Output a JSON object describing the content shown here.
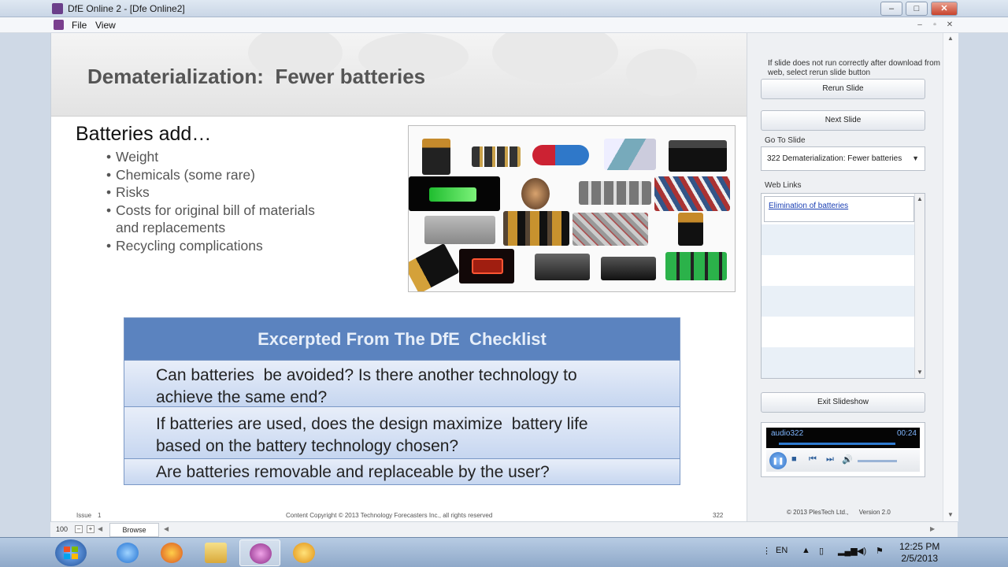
{
  "window": {
    "title": "DfE Online 2 - [Dfe Online2]",
    "min_label": "–",
    "max_label": "□",
    "close_label": "✕"
  },
  "menu": {
    "items": [
      "File",
      "View"
    ],
    "mdi": [
      "–",
      "▫",
      "✕"
    ]
  },
  "slide": {
    "title": "Dematerialization:  Fewer batteries",
    "lead": "Batteries add…",
    "bullets": [
      "Weight",
      "Chemicals (some rare)",
      "Risks",
      "Costs for original bill of materials",
      "Recycling complications"
    ],
    "bullet_continuation": "and replacements",
    "photo_alt": "batteries-collage",
    "checklist": {
      "header": "Excerpted From The DfE  Checklist",
      "rows": [
        [
          "Can batteries  be avoided? Is there another technology to",
          "achieve the same end?"
        ],
        [
          "If batteries are used, does the design maximize  battery life",
          "based on the battery technology chosen?"
        ],
        [
          "Are batteries removable and replaceable by the user?"
        ]
      ]
    },
    "footer": {
      "issue_label": "Issue",
      "issue_number": "1",
      "copyright": "Content Copyright © 2013 Technology Forecasters Inc., all rights reserved",
      "page": "322"
    }
  },
  "panel": {
    "hint": "If slide does not run correctly after download from web, select rerun slide button",
    "rerun_label": "Rerun Slide",
    "next_label": "Next Slide",
    "goto_label": "Go To Slide",
    "goto_value": "322 Dematerialization:  Fewer batteries",
    "weblinks_label": "Web Links",
    "weblinks": [
      "Elimination of batteries"
    ],
    "exit_label": "Exit Slideshow",
    "player": {
      "track": "audio322",
      "time": "00:24",
      "progress": 0.82
    },
    "copyright": "© 2013 PlesTech Ltd.,",
    "version": "Version 2.0"
  },
  "statusbar": {
    "zoom": "100",
    "tab": "Browse"
  },
  "taskbar": {
    "language": "EN",
    "time": "12:25 PM",
    "date": "2/5/2013"
  }
}
